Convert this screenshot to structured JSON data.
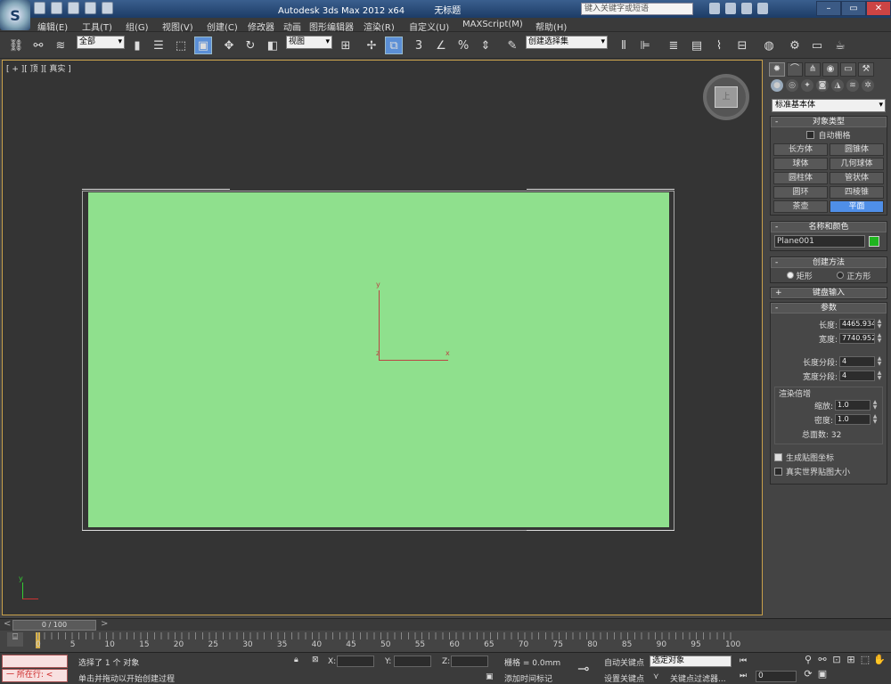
{
  "title": {
    "app": "Autodesk 3ds Max  2012 x64",
    "document": "无标题",
    "search_placeholder": "键入关键字或短语"
  },
  "menu": [
    "编辑(E)",
    "工具(T)",
    "组(G)",
    "视图(V)",
    "创建(C)",
    "修改器",
    "动画",
    "图形编辑器",
    "渲染(R)",
    "自定义(U)",
    "MAXScript(M)",
    "帮助(H)"
  ],
  "toolbar": {
    "selection_filter": "全部",
    "coord_system": "视图",
    "named_selection": "创建选择集",
    "snap_3": "3",
    "percent_snap": "%"
  },
  "viewport": {
    "label": "[ + ][ 顶 ][ 真实 ]",
    "viewcube_face": "上",
    "axis_x": "x",
    "axis_y": "y",
    "axis_z": "z",
    "plane_color": "#8fe08d"
  },
  "command_panel": {
    "category": "标准基本体",
    "object_type": {
      "title": "对象类型",
      "autogrid": "自动栅格",
      "buttons": [
        "长方体",
        "圆锥体",
        "球体",
        "几何球体",
        "圆柱体",
        "管状体",
        "圆环",
        "四棱锥",
        "茶壶",
        "平面"
      ],
      "active": "平面"
    },
    "name_color": {
      "title": "名称和颜色",
      "name": "Plane001",
      "color": "#1fb51f"
    },
    "creation_method": {
      "title": "创建方法",
      "options": [
        "矩形",
        "正方形"
      ],
      "selected": "矩形"
    },
    "keyboard_entry": "键盘输入",
    "parameters": {
      "title": "参数",
      "length_label": "长度:",
      "length": "4465.934",
      "width_label": "宽度:",
      "width": "7740.952",
      "length_segs_label": "长度分段:",
      "length_segs": "4",
      "width_segs_label": "宽度分段:",
      "width_segs": "4",
      "render_mult_title": "渲染倍增",
      "scale_label": "缩放:",
      "scale": "1.0",
      "density_label": "密度:",
      "density": "1.0",
      "total_faces": "总面数: 32",
      "gen_mapping": "生成贴图坐标",
      "real_world": "真实世界贴图大小"
    }
  },
  "timeline": {
    "frame": "0 / 100",
    "ticks": [
      "0",
      "5",
      "10",
      "15",
      "20",
      "25",
      "30",
      "35",
      "40",
      "45",
      "50",
      "55",
      "60",
      "65",
      "70",
      "75",
      "80",
      "85",
      "90",
      "95",
      "100"
    ]
  },
  "status": {
    "maxscript_line": "一  所在行:  <",
    "selected": "选择了 1 个 对象",
    "prompt": "单击并拖动以开始创建过程",
    "x_label": "X:",
    "y_label": "Y:",
    "z_label": "Z:",
    "grid": "栅格 = 0.0mm",
    "add_time_tag": "添加时间标记",
    "auto_key": "自动关键点",
    "set_key": "设置关键点",
    "selected_obj": "选定对象",
    "key_filters": "关键点过滤器...",
    "frame_value": "0"
  }
}
